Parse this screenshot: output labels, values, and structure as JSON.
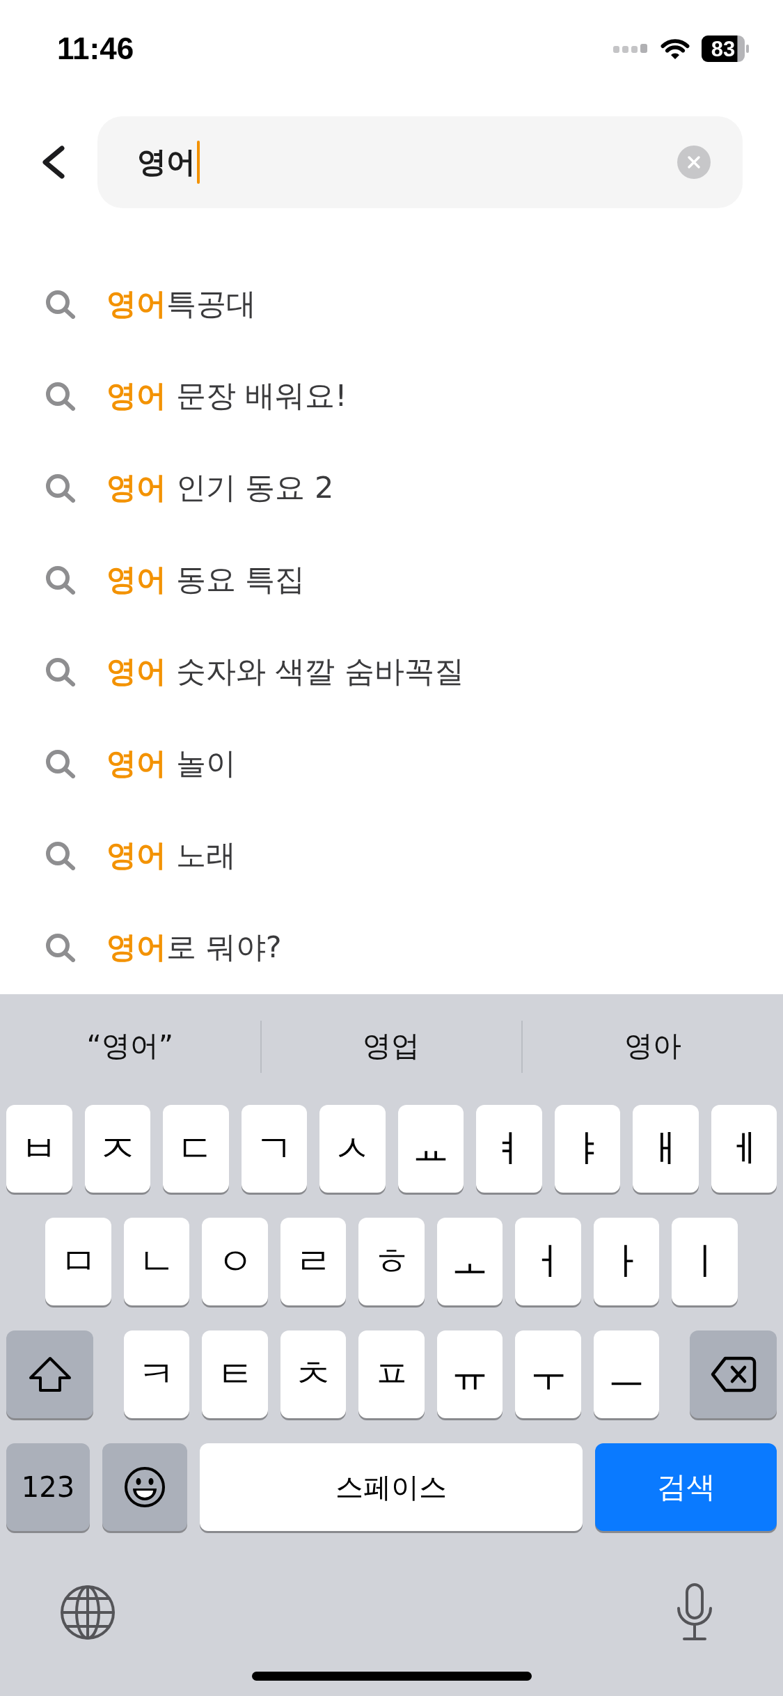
{
  "status_bar": {
    "time": "11:46",
    "battery": "83"
  },
  "search": {
    "value": "영어",
    "focused": true
  },
  "suggestions": [
    {
      "text": "**영어**특공대"
    },
    {
      "text": "**영어** 문장 배워요!"
    },
    {
      "text": "**영어** 인기 동요 2"
    },
    {
      "text": "**영어** 동요 특집"
    },
    {
      "text": "**영어** 숫자와 색깔 숨바꼭질"
    },
    {
      "text": "**영어** 놀이"
    },
    {
      "text": "**영어** 노래"
    },
    {
      "text": "**영어**로 뭐야?"
    }
  ],
  "keyboard": {
    "candidates": [
      {
        "text": "“영어”"
      },
      {
        "text": "영업"
      },
      {
        "text": "영아"
      }
    ],
    "row_1": [
      {
        "kind": "letter",
        "label": "ㅂ"
      },
      {
        "kind": "letter",
        "label": "ㅈ"
      },
      {
        "kind": "letter",
        "label": "ㄷ"
      },
      {
        "kind": "letter",
        "label": "ㄱ"
      },
      {
        "kind": "letter",
        "label": "ㅅ"
      },
      {
        "kind": "letter",
        "label": "ㅛ"
      },
      {
        "kind": "letter",
        "label": "ㅕ"
      },
      {
        "kind": "letter",
        "label": "ㅑ"
      },
      {
        "kind": "letter",
        "label": "ㅐ"
      },
      {
        "kind": "letter",
        "label": "ㅔ"
      }
    ],
    "row_2": [
      {
        "kind": "letter",
        "label": "ㅁ"
      },
      {
        "kind": "letter",
        "label": "ㄴ"
      },
      {
        "kind": "letter",
        "label": "ㅇ"
      },
      {
        "kind": "letter",
        "label": "ㄹ"
      },
      {
        "kind": "letter",
        "label": "ㅎ"
      },
      {
        "kind": "letter",
        "label": "ㅗ"
      },
      {
        "kind": "letter",
        "label": "ㅓ"
      },
      {
        "kind": "letter",
        "label": "ㅏ"
      },
      {
        "kind": "letter",
        "label": "ㅣ"
      }
    ],
    "row_3": [
      {
        "kind": "shift"
      },
      {
        "kind": "letter",
        "label": "ㅋ"
      },
      {
        "kind": "letter",
        "label": "ㅌ"
      },
      {
        "kind": "letter",
        "label": "ㅊ"
      },
      {
        "kind": "letter",
        "label": "ㅍ"
      },
      {
        "kind": "letter",
        "label": "ㅠ"
      },
      {
        "kind": "letter",
        "label": "ㅜ"
      },
      {
        "kind": "letter",
        "label": "ㅡ"
      },
      {
        "kind": "delete"
      }
    ],
    "bottom_row": [
      {
        "kind": "number",
        "label": "123"
      },
      {
        "kind": "emoji"
      },
      {
        "kind": "space",
        "label": "스페이스"
      },
      {
        "kind": "return",
        "label": "검색"
      }
    ]
  }
}
